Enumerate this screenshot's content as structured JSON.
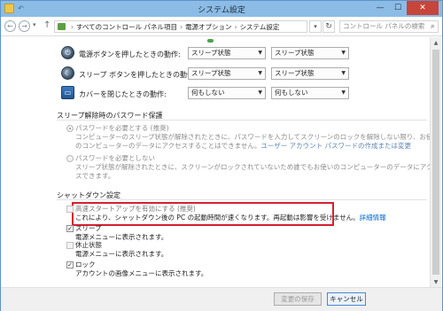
{
  "window": {
    "title": "システム設定"
  },
  "address": {
    "crumbs": [
      "すべてのコントロール パネル項目",
      "電源オプション",
      "システム設定"
    ],
    "search_placeholder": "コントロール パネルの検索"
  },
  "power_rows": [
    {
      "label": "電源ボタンを押したときの動作:",
      "battery": "スリープ状態",
      "plugged": "スリープ状態",
      "icon": "power-button-icon"
    },
    {
      "label": "スリープ ボタンを押したときの動作:",
      "battery": "スリープ状態",
      "plugged": "スリープ状態",
      "icon": "sleep-button-icon"
    },
    {
      "label": "カバーを閉じたときの動作:",
      "battery": "何もしない",
      "plugged": "何もしない",
      "icon": "laptop-lid-icon"
    }
  ],
  "password": {
    "heading": "スリープ解除時のパスワード保護",
    "require": {
      "label": "パスワードを必要とする (推奨)",
      "desc1": "コンピューターのスリープ状態が解除されたときに、パスワードを入力してスクリーンのロックを解除しない限り、お使い",
      "desc2": "のコンピューターのデータにアクセスすることはできません。",
      "link": "ユーザー アカウント パスワードの作成または変更"
    },
    "norequire": {
      "label": "パスワードを必要としない",
      "desc1": "スリープ状態が解除されたときに、スクリーンがロックされていないため誰でもお使いのコンピューターのデータにアクセ",
      "desc2": "スできます。"
    }
  },
  "shutdown": {
    "heading": "シャットダウン設定",
    "items": [
      {
        "label": "高速スタートアップを有効にする (推奨)",
        "desc": "これにより、シャットダウン後の PC の起動時間が速くなります。再起動は影響を受けません。",
        "link": "詳細情報",
        "checked": false
      },
      {
        "label": "スリープ",
        "desc": "電源メニューに表示されます。",
        "checked": true
      },
      {
        "label": "休止状態",
        "desc": "電源メニューに表示されます。",
        "checked": false
      },
      {
        "label": "ロック",
        "desc": "アカウントの画像メニューに表示されます。",
        "checked": true
      }
    ]
  },
  "footer": {
    "save": "変更の保存",
    "cancel": "キャンセル"
  }
}
